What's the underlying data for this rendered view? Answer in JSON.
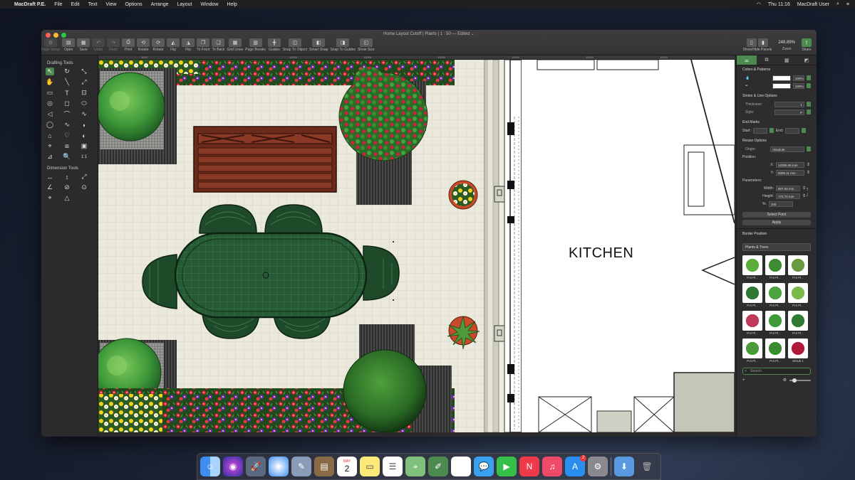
{
  "menubar": {
    "app": "MacDraft P.E.",
    "items": [
      "File",
      "Edit",
      "Text",
      "View",
      "Options",
      "Arrange",
      "Layout",
      "Window",
      "Help"
    ],
    "clock": "Thu 11:16",
    "user": "MacDraft User"
  },
  "window": {
    "title": "Home Layout Cutoff | Plants | 1 : 50 — Edited ⌄"
  },
  "toolbar": {
    "left": [
      {
        "label": "Page Setup",
        "icon": "⚙",
        "dim": true
      },
      {
        "label": "Open",
        "icon": "▤",
        "dim": false
      },
      {
        "label": "Save",
        "icon": "▦",
        "dim": false
      },
      {
        "label": "Undo",
        "icon": "↶",
        "dim": true
      },
      {
        "label": "Redo",
        "icon": "↷",
        "dim": true
      },
      {
        "label": "Print",
        "icon": "⎙",
        "dim": false
      },
      {
        "label": "Rotate",
        "icon": "⟲",
        "dim": false
      },
      {
        "label": "Rotate",
        "icon": "⟳",
        "dim": false
      },
      {
        "label": "Flip",
        "icon": "◭",
        "dim": false
      },
      {
        "label": "Flip",
        "icon": "◮",
        "dim": false
      },
      {
        "label": "To Front",
        "icon": "❐",
        "dim": false
      },
      {
        "label": "To Back",
        "icon": "❏",
        "dim": false
      },
      {
        "label": "Grid Lines",
        "icon": "▦",
        "dim": false
      },
      {
        "label": "Page Breaks",
        "icon": "▥",
        "dim": false
      },
      {
        "label": "Guides",
        "icon": "╋",
        "dim": false
      },
      {
        "label": "Snap To Object",
        "icon": "◫",
        "dim": false
      },
      {
        "label": "Smart Snap",
        "icon": "◧",
        "dim": false
      },
      {
        "label": "Snap To Guides",
        "icon": "◨",
        "dim": false
      },
      {
        "label": "Show Size",
        "icon": "◰",
        "dim": false
      }
    ],
    "show_hide": "Show/Hide Panels",
    "zoom_value": "248.89%",
    "zoom_label": "Zoom",
    "share": "Share"
  },
  "tools": {
    "drafting_title": "Drafting Tools",
    "drafting": [
      "↖",
      "↻",
      "⤡",
      "✋",
      "╲",
      "⤢",
      "▭",
      "T",
      "⊡",
      "◎",
      "◻",
      "⬭",
      "◁",
      "⌒",
      "∿",
      "◯",
      "∿",
      "◗",
      "⌂",
      "♡",
      "◐",
      "⌖",
      "⧈",
      "▣",
      "⊿",
      "🔍",
      "1:1"
    ],
    "dimension_title": "Dimension Tools",
    "dimension": [
      "↔",
      "↕",
      "⤢",
      "∠",
      "⊘",
      "⊙",
      "⌖",
      "△"
    ]
  },
  "ruler": {
    "marks": [
      "3000",
      "11000",
      "12000",
      "13000",
      "14000",
      "15000",
      "16000"
    ]
  },
  "canvas": {
    "kitchen_label": "KITCHEN"
  },
  "panel": {
    "colors_title": "Colors & Patterns",
    "fill_pct": "100%",
    "line_pct": "100%",
    "stroke_title": "Stroke & Line Options",
    "thickness_label": "Thickness:",
    "thickness_value": "1",
    "style_label": "Style:",
    "style_value": "P",
    "endmarks_title": "End Marks",
    "start_label": "Start:",
    "end_label": "End:",
    "resize_title": "Resize Options",
    "origin_label": "Origin:",
    "origin_value": "Absolute",
    "position_label": "Position:",
    "x_label": "X:",
    "x_value": "12285.46 mm",
    "y_label": "Y:",
    "y_value": "5089.11 mm",
    "params_label": "Parameters:",
    "width_label": "Width:",
    "width_value": "807.04 mm",
    "height_label": "Height:",
    "height_value": "772.70 mm",
    "pct_label": "%:",
    "pct_value": "100",
    "select_point": "Select Point",
    "apply": "Apply",
    "border_position": "Border Position",
    "library_select": "Plants & Trees",
    "library_items": [
      "Pot Pl...",
      "Pot Pl...",
      "Pot Pl...",
      "Pot Pl...",
      "Pot Pl...",
      "Pot Pl...",
      "Pot Pl...",
      "Pot Pl...",
      "Pot Pl...",
      "Pot Pl...",
      "Pot Pl...",
      "Shrub 1"
    ],
    "search_placeholder": "Search"
  },
  "dock": {
    "calendar_month": "MAY",
    "calendar_day": "2",
    "appstore_badge": "2"
  }
}
